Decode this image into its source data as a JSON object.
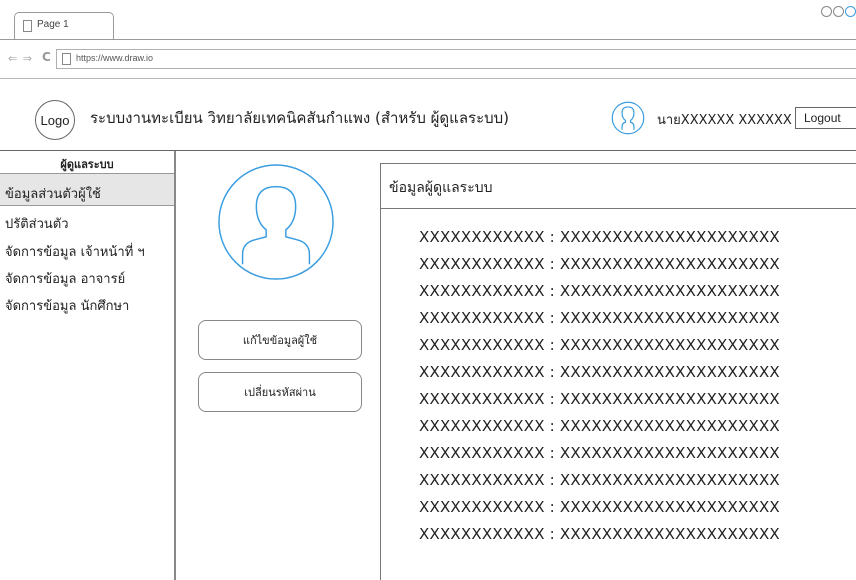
{
  "browser": {
    "tab_label": "Page 1",
    "nav_glyphs": "⇐ ⇒",
    "reload_glyph": "C",
    "url": "https://www.draw.io"
  },
  "header": {
    "logo_text": "Logo",
    "title": "ระบบงานทะเบียน วิทยาลัยเทคนิคสันกำแพง (สำหรับ ผู้ดูแลระบบ)",
    "username": "นายXXXXXX XXXXXX",
    "logout_label": "Logout"
  },
  "sidebar": {
    "title": "ผู้ดูแลระบบ",
    "items": [
      {
        "label": "ข้อมูลส่วนตัวผู้ใช้",
        "active": true
      },
      {
        "label": "ปรัติส่วนตัว"
      },
      {
        "label": "จัดการข้อมูล เจ้าหน้าที่ ฯ"
      },
      {
        "label": "จัดการข้อมูล อาจารย์"
      },
      {
        "label": "จัดการข้อมูล นักศึกษา"
      }
    ]
  },
  "actions": {
    "edit_label": "แก้ไขข้อมูลผู้ใช้",
    "change_password_label": "เปลี่ยนรหัสผ่าน"
  },
  "panel": {
    "title": "ข้อมูลผู้ดูแลระบบ",
    "rows": [
      "XXXXXXXXXXXX : XXXXXXXXXXXXXXXXXXXXX",
      "XXXXXXXXXXXX : XXXXXXXXXXXXXXXXXXXXX",
      "XXXXXXXXXXXX : XXXXXXXXXXXXXXXXXXXXX",
      "XXXXXXXXXXXX : XXXXXXXXXXXXXXXXXXXXX",
      "XXXXXXXXXXXX : XXXXXXXXXXXXXXXXXXXXX",
      "XXXXXXXXXXXX : XXXXXXXXXXXXXXXXXXXXX",
      "XXXXXXXXXXXX : XXXXXXXXXXXXXXXXXXXXX",
      "XXXXXXXXXXXX : XXXXXXXXXXXXXXXXXXXXX",
      "XXXXXXXXXXXX : XXXXXXXXXXXXXXXXXXXXX",
      "XXXXXXXXXXXX : XXXXXXXXXXXXXXXXXXXXX",
      "XXXXXXXXXXXX : XXXXXXXXXXXXXXXXXXXXX",
      "XXXXXXXXXXXX : XXXXXXXXXXXXXXXXXXXXX"
    ]
  },
  "colors": {
    "avatar_stroke": "#3a9de0",
    "active_item_bg": "#e6e6e6"
  }
}
